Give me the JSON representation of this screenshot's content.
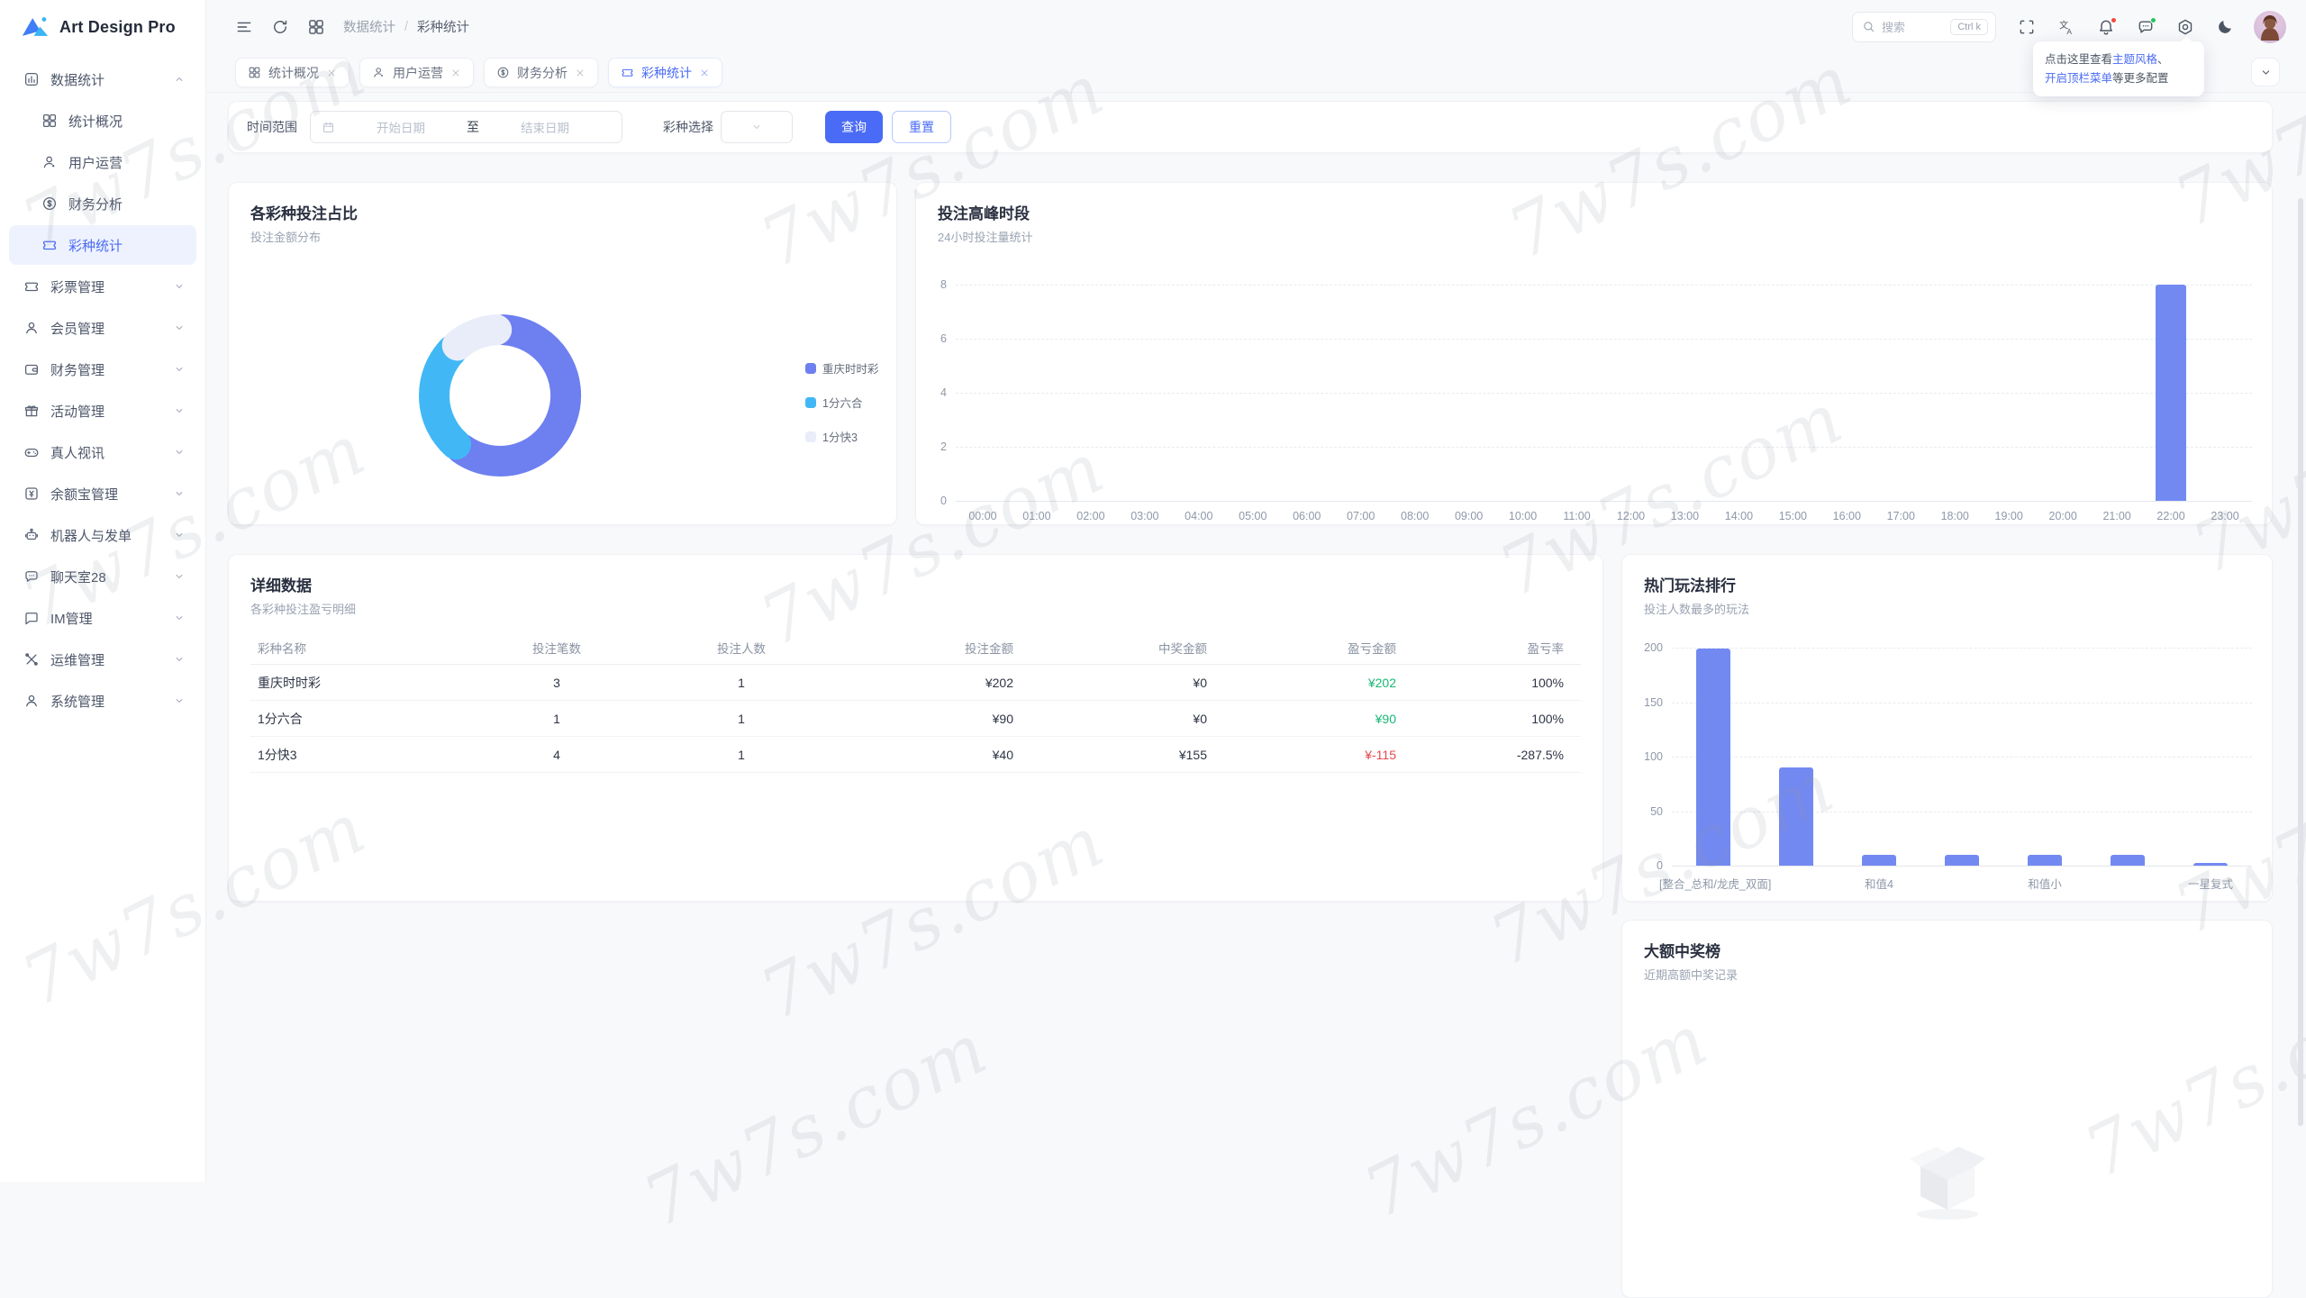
{
  "app": {
    "name": "Art Design Pro"
  },
  "header": {
    "breadcrumb_parent": "数据统计",
    "breadcrumb_sep": "/",
    "breadcrumb_current": "彩种统计",
    "search": {
      "placeholder": "搜索",
      "shortcut": "Ctrl k"
    }
  },
  "tooltip": {
    "part1": "点击这里查看",
    "link1": "主题风格",
    "sep": "、",
    "link2": "开启顶栏菜单",
    "part2": "等更多配置"
  },
  "sidebar": {
    "items": [
      {
        "label": "数据统计"
      },
      {
        "label": "统计概况"
      },
      {
        "label": "用户运营"
      },
      {
        "label": "财务分析"
      },
      {
        "label": "彩种统计"
      },
      {
        "label": "彩票管理"
      },
      {
        "label": "会员管理"
      },
      {
        "label": "财务管理"
      },
      {
        "label": "活动管理"
      },
      {
        "label": "真人视讯"
      },
      {
        "label": "余额宝管理"
      },
      {
        "label": "机器人与发单"
      },
      {
        "label": "聊天室28"
      },
      {
        "label": "IM管理"
      },
      {
        "label": "运维管理"
      },
      {
        "label": "系统管理"
      }
    ]
  },
  "tabs": [
    {
      "label": "统计概况"
    },
    {
      "label": "用户运营"
    },
    {
      "label": "财务分析"
    },
    {
      "label": "彩种统计"
    }
  ],
  "filter": {
    "date_label": "时间范围",
    "start_placeholder": "开始日期",
    "to": "至",
    "end_placeholder": "结束日期",
    "lottery_label": "彩种选择",
    "query": "查询",
    "reset": "重置"
  },
  "cards": {
    "donut": {
      "title": "各彩种投注占比",
      "subtitle": "投注金额分布"
    },
    "peak": {
      "title": "投注高峰时段",
      "subtitle": "24小时投注量统计"
    },
    "detail": {
      "title": "详细数据",
      "subtitle": "各彩种投注盈亏明细",
      "headers": [
        "彩种名称",
        "投注笔数",
        "投注人数",
        "投注金额",
        "中奖金额",
        "盈亏金额",
        "盈亏率"
      ],
      "rows": [
        {
          "name": "重庆时时彩",
          "bets": "3",
          "users": "1",
          "amount": "¥202",
          "win": "¥0",
          "profit": "¥202",
          "rate": "100%"
        },
        {
          "name": "1分六合",
          "bets": "1",
          "users": "1",
          "amount": "¥90",
          "win": "¥0",
          "profit": "¥90",
          "rate": "100%"
        },
        {
          "name": "1分快3",
          "bets": "4",
          "users": "1",
          "amount": "¥40",
          "win": "¥155",
          "profit": "¥-115",
          "rate": "-287.5%"
        }
      ]
    },
    "hot": {
      "title": "热门玩法排行",
      "subtitle": "投注人数最多的玩法"
    },
    "jackpot": {
      "title": "大额中奖榜",
      "subtitle": "近期高额中奖记录"
    }
  },
  "chart_data": [
    {
      "type": "pie",
      "title": "各彩种投注占比",
      "subtitle": "投注金额分布",
      "donut": true,
      "legend_position": "right",
      "series": [
        {
          "name": "重庆时时彩",
          "value": 202,
          "color": "#6e7ff0"
        },
        {
          "name": "1分六合",
          "value": 90,
          "color": "#41b8f5"
        },
        {
          "name": "1分快3",
          "value": 40,
          "color": "#e9edfa"
        }
      ]
    },
    {
      "type": "bar",
      "title": "投注高峰时段",
      "subtitle": "24小时投注量统计",
      "x": [
        "00:00",
        "01:00",
        "02:00",
        "03:00",
        "04:00",
        "05:00",
        "06:00",
        "07:00",
        "08:00",
        "09:00",
        "10:00",
        "11:00",
        "12:00",
        "13:00",
        "14:00",
        "15:00",
        "16:00",
        "17:00",
        "18:00",
        "19:00",
        "20:00",
        "21:00",
        "22:00",
        "23:00"
      ],
      "values": [
        0,
        0,
        0,
        0,
        0,
        0,
        0,
        0,
        0,
        0,
        0,
        0,
        0,
        0,
        0,
        0,
        0,
        0,
        0,
        0,
        0,
        0,
        8,
        0
      ],
      "yticks": [
        0,
        2,
        4,
        6,
        8
      ],
      "ylim": [
        0,
        8
      ],
      "bar_color": "#7389f2",
      "grid": true
    },
    {
      "type": "bar",
      "title": "热门玩法排行",
      "subtitle": "投注人数最多的玩法",
      "categories": [
        "[整合_总和/龙虎_双面]",
        "",
        "和值4",
        "",
        "和值小",
        "",
        "一星复式"
      ],
      "values": [
        199,
        90,
        10,
        10,
        10,
        10,
        2
      ],
      "yticks": [
        0,
        50,
        100,
        150,
        200
      ],
      "ylim": [
        0,
        200
      ],
      "bar_color": "#7389f2",
      "grid": true
    }
  ],
  "colors": {
    "primary": "#4a6bf5",
    "bar": "#7389f2",
    "profit_green": "#18b877",
    "loss_red": "#e5484d"
  },
  "watermark": {
    "text": "7w7s.com"
  }
}
